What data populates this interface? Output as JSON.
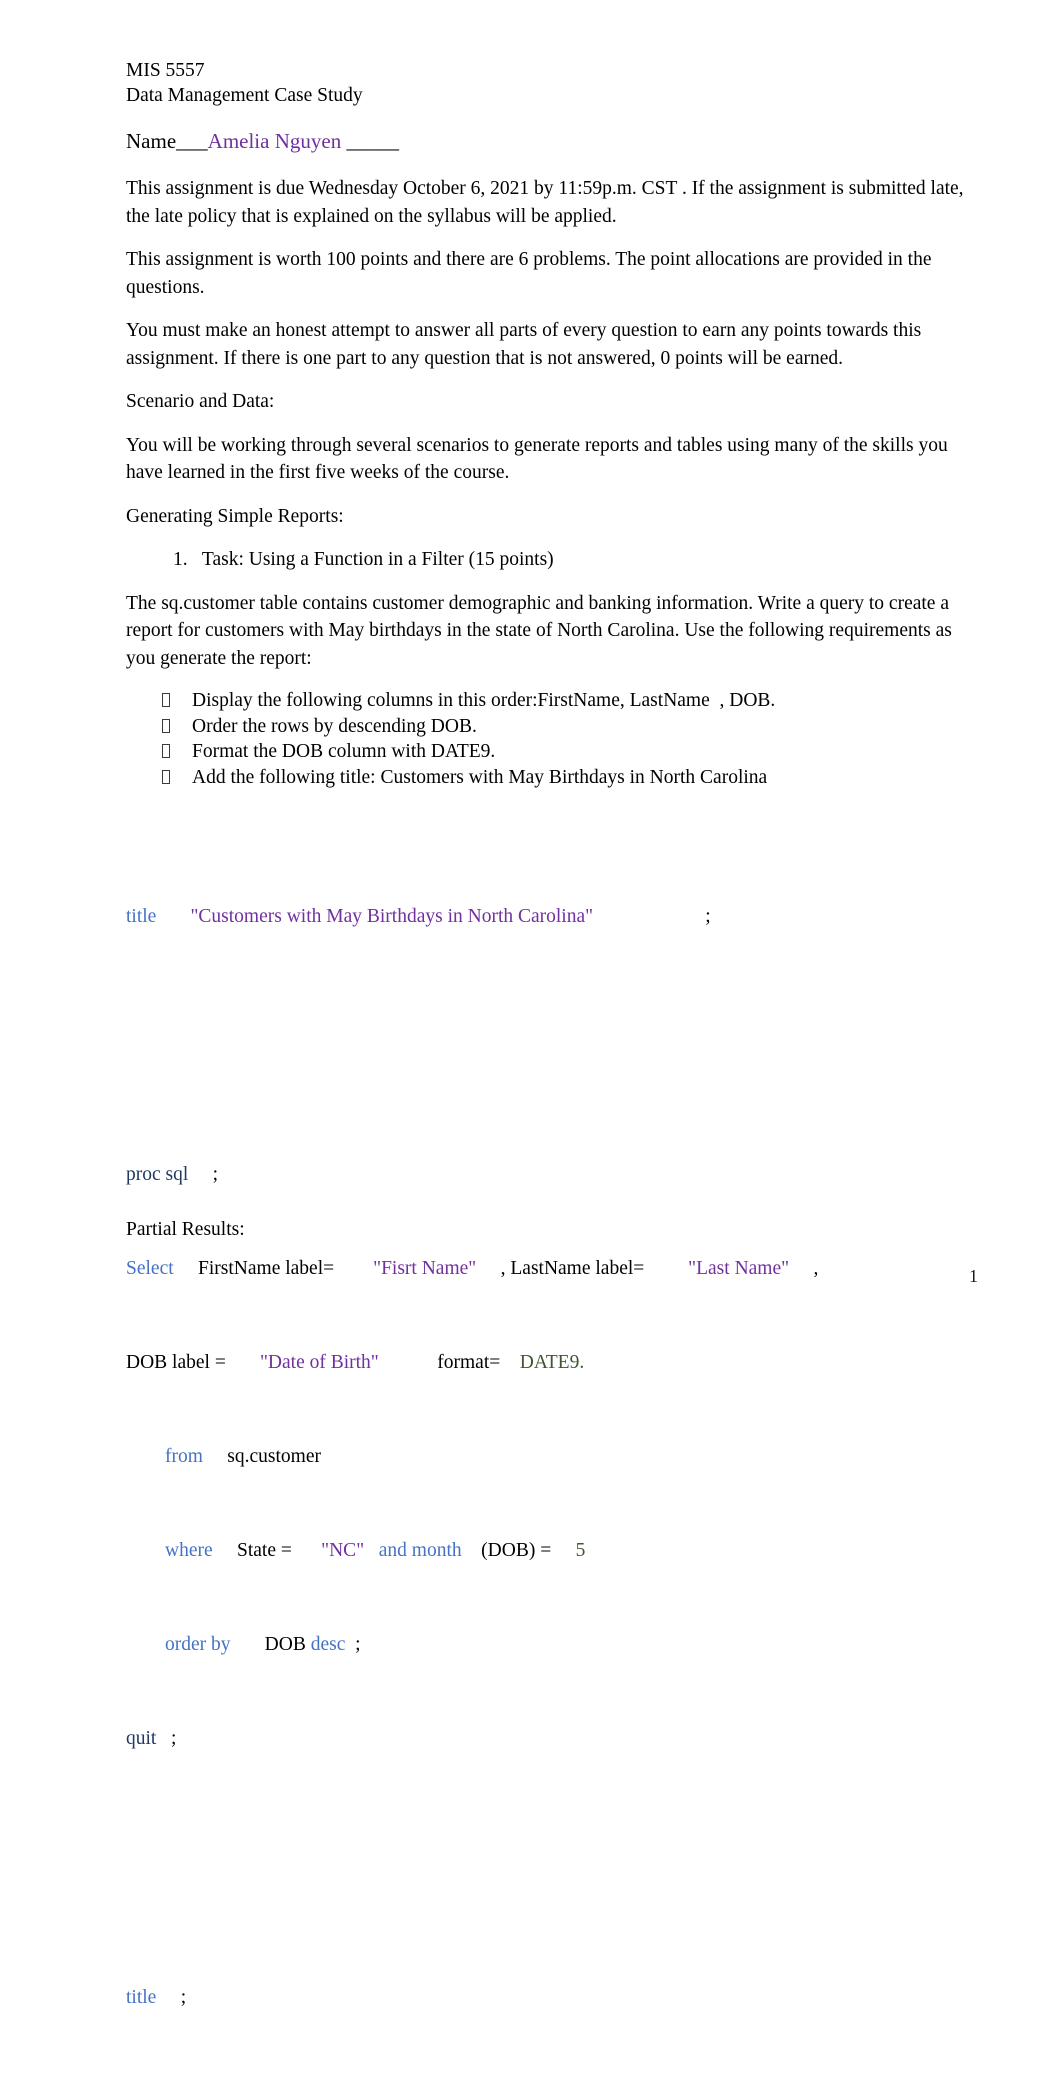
{
  "header": {
    "course_code": "MIS 5557",
    "document_title": "Data Management Case Study",
    "name_label": "Name",
    "name_rule_before": "___",
    "name_value": "Amelia Nguyen",
    "name_rule_after": " _____"
  },
  "paragraphs": {
    "due_date": "This assignment is due Wednesday October 6, 2021 by 11:59p.m. CST . If the assignment is submitted late, the late policy that is explained on the syllabus will be applied.",
    "points": "This assignment is worth 100 points and there are 6 problems. The point allocations are provided in the questions.",
    "honest_attempt": "You must make an honest attempt to answer all parts of every question to earn any points towards this assignment. If there is one part to any question that is not answered, 0 points will be earned.",
    "scenario_heading": "Scenario and Data:",
    "scenario_body": "You will be working through several scenarios to generate reports and tables using many of the skills you have learned in the first five weeks of the course.",
    "reports_heading": "Generating Simple Reports:",
    "task_1": "1.   Task: Using a Function in a Filter (15 points)",
    "task_description": "The sq.customer  table contains customer demographic and banking information. Write a query to create a report for customers with May birthdays in the state of North Carolina. Use the following requirements as you generate the report:"
  },
  "requirements": [
    "Display the following columns in this order:FirstName, LastName  , DOB.",
    "Order the rows by descending DOB.",
    "Format the DOB column with DATE9.",
    "Add the following title: Customers with May Birthdays in North Carolina"
  ],
  "code": {
    "title_kw": "title",
    "title_gap": "       ",
    "title_string": "\"Customers with May Birthdays in North Carolina\"",
    "title_tail_gap": "                       ",
    "title_semicolon": ";",
    "proc_sql": "proc sql",
    "proc_sql_gap": "     ",
    "proc_sql_semicolon": ";",
    "select_kw": "Select",
    "select_gap": "     ",
    "firstname_expr": "FirstName label=",
    "firstname_gap": "        ",
    "firstname_label": "\"Fisrt Name\"",
    "lastname_sep": "     , LastName label=",
    "lastname_gap": "         ",
    "lastname_label": "\"Last Name\"",
    "lastname_comma": "     ,",
    "dob_expr": "DOB label =",
    "dob_gap": "       ",
    "dob_label": "\"Date of Birth\"",
    "format_gap": "            ",
    "format_expr": "format=",
    "format_value_gap": "    ",
    "format_value": "DATE9.",
    "from_indent": "        ",
    "from_kw": "from",
    "from_gap": "     ",
    "from_table": "sq.customer",
    "where_indent": "        ",
    "where_kw": "where",
    "where_gap": "     ",
    "where_col": "State =",
    "where_val_gap": "      ",
    "where_val": "\"NC\"",
    "and_month": "   and month",
    "dob_func_gap": "    ",
    "dob_func": "(DOB) =",
    "dob_func_val_gap": "     ",
    "dob_func_val": "5",
    "orderby_indent": "        ",
    "orderby_kw": "order by",
    "orderby_gap": "       ",
    "orderby_col": "DOB",
    "orderby_desc": "desc",
    "orderby_semicolon": "  ;",
    "quit_kw": "quit",
    "quit_gap": "   ",
    "quit_semicolon": ";",
    "title_end_kw": "title",
    "title_end_gap": "     ",
    "title_end_semicolon": ";"
  },
  "footer": {
    "partial_results": "Partial Results:",
    "page_number": "1"
  },
  "colors": {
    "name_purple": "#7030A0",
    "keyword_blue": "#4472C4",
    "keyword_dark_blue": "#1F3864",
    "string_purple": "#7030A0",
    "numeric_green": "#3F5630"
  }
}
